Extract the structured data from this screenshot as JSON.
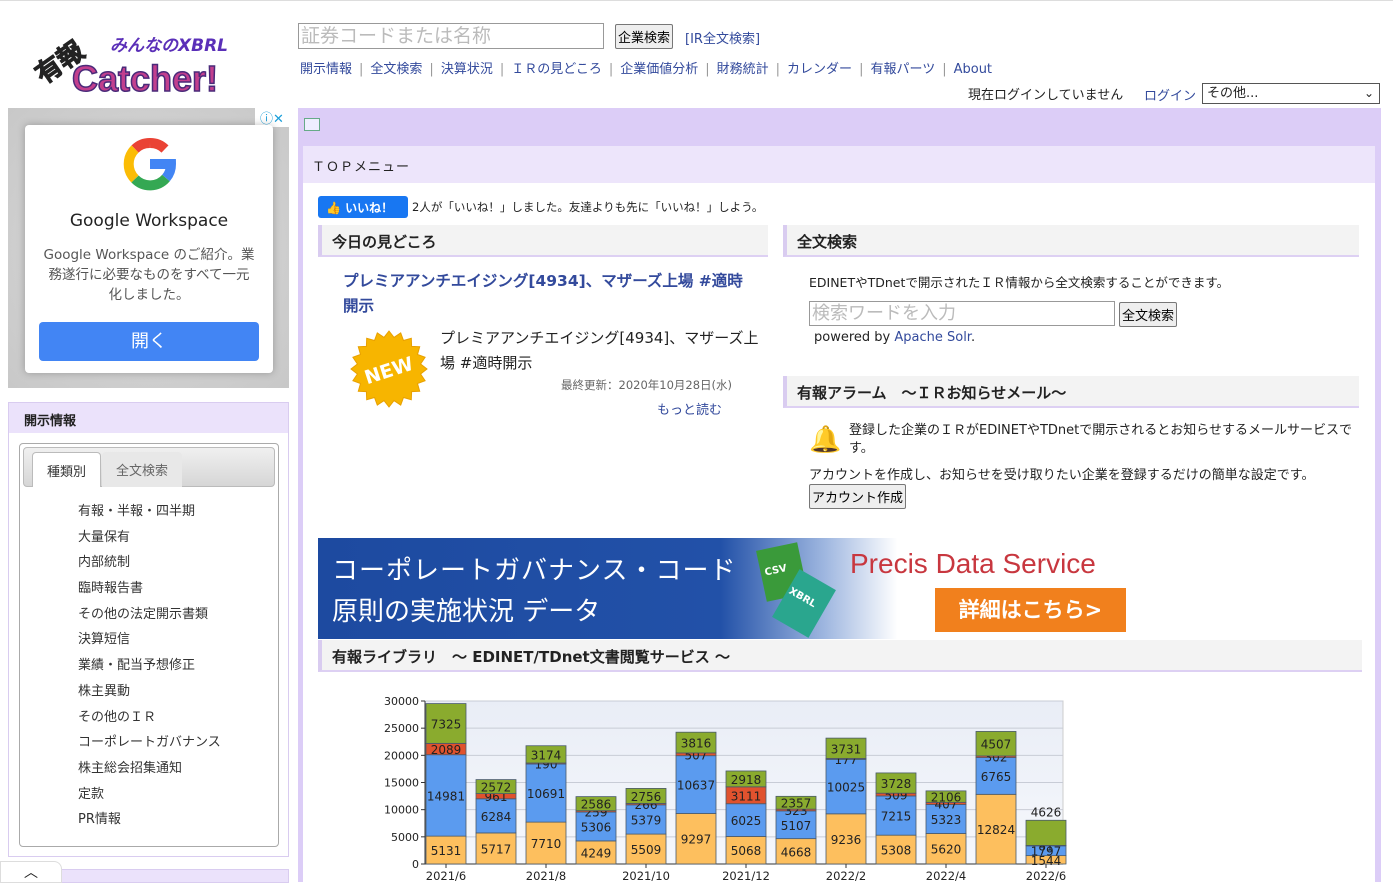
{
  "header": {
    "logo_text": "みんなのXBRL 有報 Catcher!",
    "search_placeholder": "証券コードまたは名称",
    "search_button": "企業検索",
    "ir_fulltext_link": "[IR全文検索]",
    "nav": [
      "開示情報",
      "全文検索",
      "決算状況",
      "ＩＲの見どころ",
      "企業価値分析",
      "財務統計",
      "カレンダー",
      "有報パーツ",
      "About"
    ],
    "login_status": "現在ログインしていません",
    "login_link": "ログイン",
    "other_select": "その他..."
  },
  "ad": {
    "brand": "Google Workspace",
    "desc": "Google Workspace のご紹介。業務遂行に必要なものをすべて一元化しました。",
    "button": "開く"
  },
  "sidebar": {
    "title": "開示情報",
    "tabs": [
      "種類別",
      "全文検索"
    ],
    "items": [
      "有報・半報・四半期",
      "大量保有",
      "内部統制",
      "臨時報告書",
      "その他の法定開示書類",
      "決算短信",
      "業績・配当予想修正",
      "株主異動",
      "その他のＩＲ",
      "コーポレートガバナンス",
      "株主総会招集通知",
      "定款",
      "PR情報"
    ]
  },
  "main": {
    "top_menu": "ＴＯＰメニュー",
    "fb_like": "いいね！",
    "fb_text": "2人が「いいね！」しました。友達よりも先に「いいね！」しよう。",
    "pick": {
      "title": "今日の見どころ",
      "link": "プレミアアンチエイジング[4934]、マザーズ上場 #適時開示",
      "badge": "NEW",
      "body": "プレミアアンチエイジング[4934]、マザーズ上場 #適時開示",
      "date": "最終更新：2020年10月28日(水)",
      "more": "もっと読む"
    },
    "fulltext": {
      "title": "全文検索",
      "desc": "EDINETやTDnetで開示されたＩＲ情報から全文検索することができます。",
      "placeholder": "検索ワードを入力",
      "button": "全文検索",
      "powered_prefix": "powered by ",
      "powered_link": "Apache Solr",
      "powered_suffix": "."
    },
    "alarm": {
      "title": "有報アラーム　～ＩＲお知らせメール～",
      "text1": "登録した企業のＩＲがEDINETやTDnetで開示されるとお知らせするメールサービスです。",
      "text2": "アカウントを作成し、お知らせを受け取りたい企業を登録するだけの簡単な設定です。",
      "button": "アカウント作成"
    },
    "banner": {
      "line1": "コーポレートガバナンス・コード",
      "line2": "原則の実施状況 データ",
      "csv": "CSV",
      "xbrl": "XBRL",
      "brand": "Precis Data Service",
      "cta": "詳細はこちら>"
    },
    "library": {
      "title": "有報ライブラリ　～ EDINET/TDnet文書閲覧サービス ～"
    }
  },
  "chart_data": {
    "type": "bar",
    "stacked": true,
    "ylim": [
      0,
      30000
    ],
    "yticks": [
      0,
      5000,
      10000,
      15000,
      20000,
      25000,
      30000
    ],
    "categories": [
      "2021/6",
      "2021/7",
      "2021/8",
      "2021/9",
      "2021/10",
      "2021/11",
      "2021/12",
      "2022/1",
      "2022/2",
      "2022/3",
      "2022/4",
      "2022/5",
      "2022/6"
    ],
    "xtick_labels": [
      "2021/6",
      "",
      "2021/8",
      "",
      "2021/10",
      "",
      "2021/12",
      "",
      "2022/2",
      "",
      "2022/4",
      "",
      "2022/6"
    ],
    "grid": true,
    "series": [
      {
        "color": "#fdbf5e",
        "values": [
          5131,
          5717,
          7710,
          4249,
          5509,
          9297,
          5068,
          4668,
          9236,
          5308,
          5620,
          12824,
          1544
        ]
      },
      {
        "color": "#5b9bef",
        "values": [
          14981,
          6284,
          10691,
          5306,
          5379,
          10637,
          6025,
          5107,
          10025,
          7215,
          5323,
          6765,
          1797
        ]
      },
      {
        "color": "#e0522e",
        "values": [
          2089,
          961,
          190,
          259,
          266,
          507,
          3111,
          323,
          177,
          509,
          407,
          302,
          81
        ]
      },
      {
        "color": "#8aab2e",
        "values": [
          7325,
          2572,
          3174,
          2586,
          2756,
          3816,
          2918,
          2357,
          3731,
          3728,
          2106,
          4507,
          4626
        ]
      }
    ]
  }
}
